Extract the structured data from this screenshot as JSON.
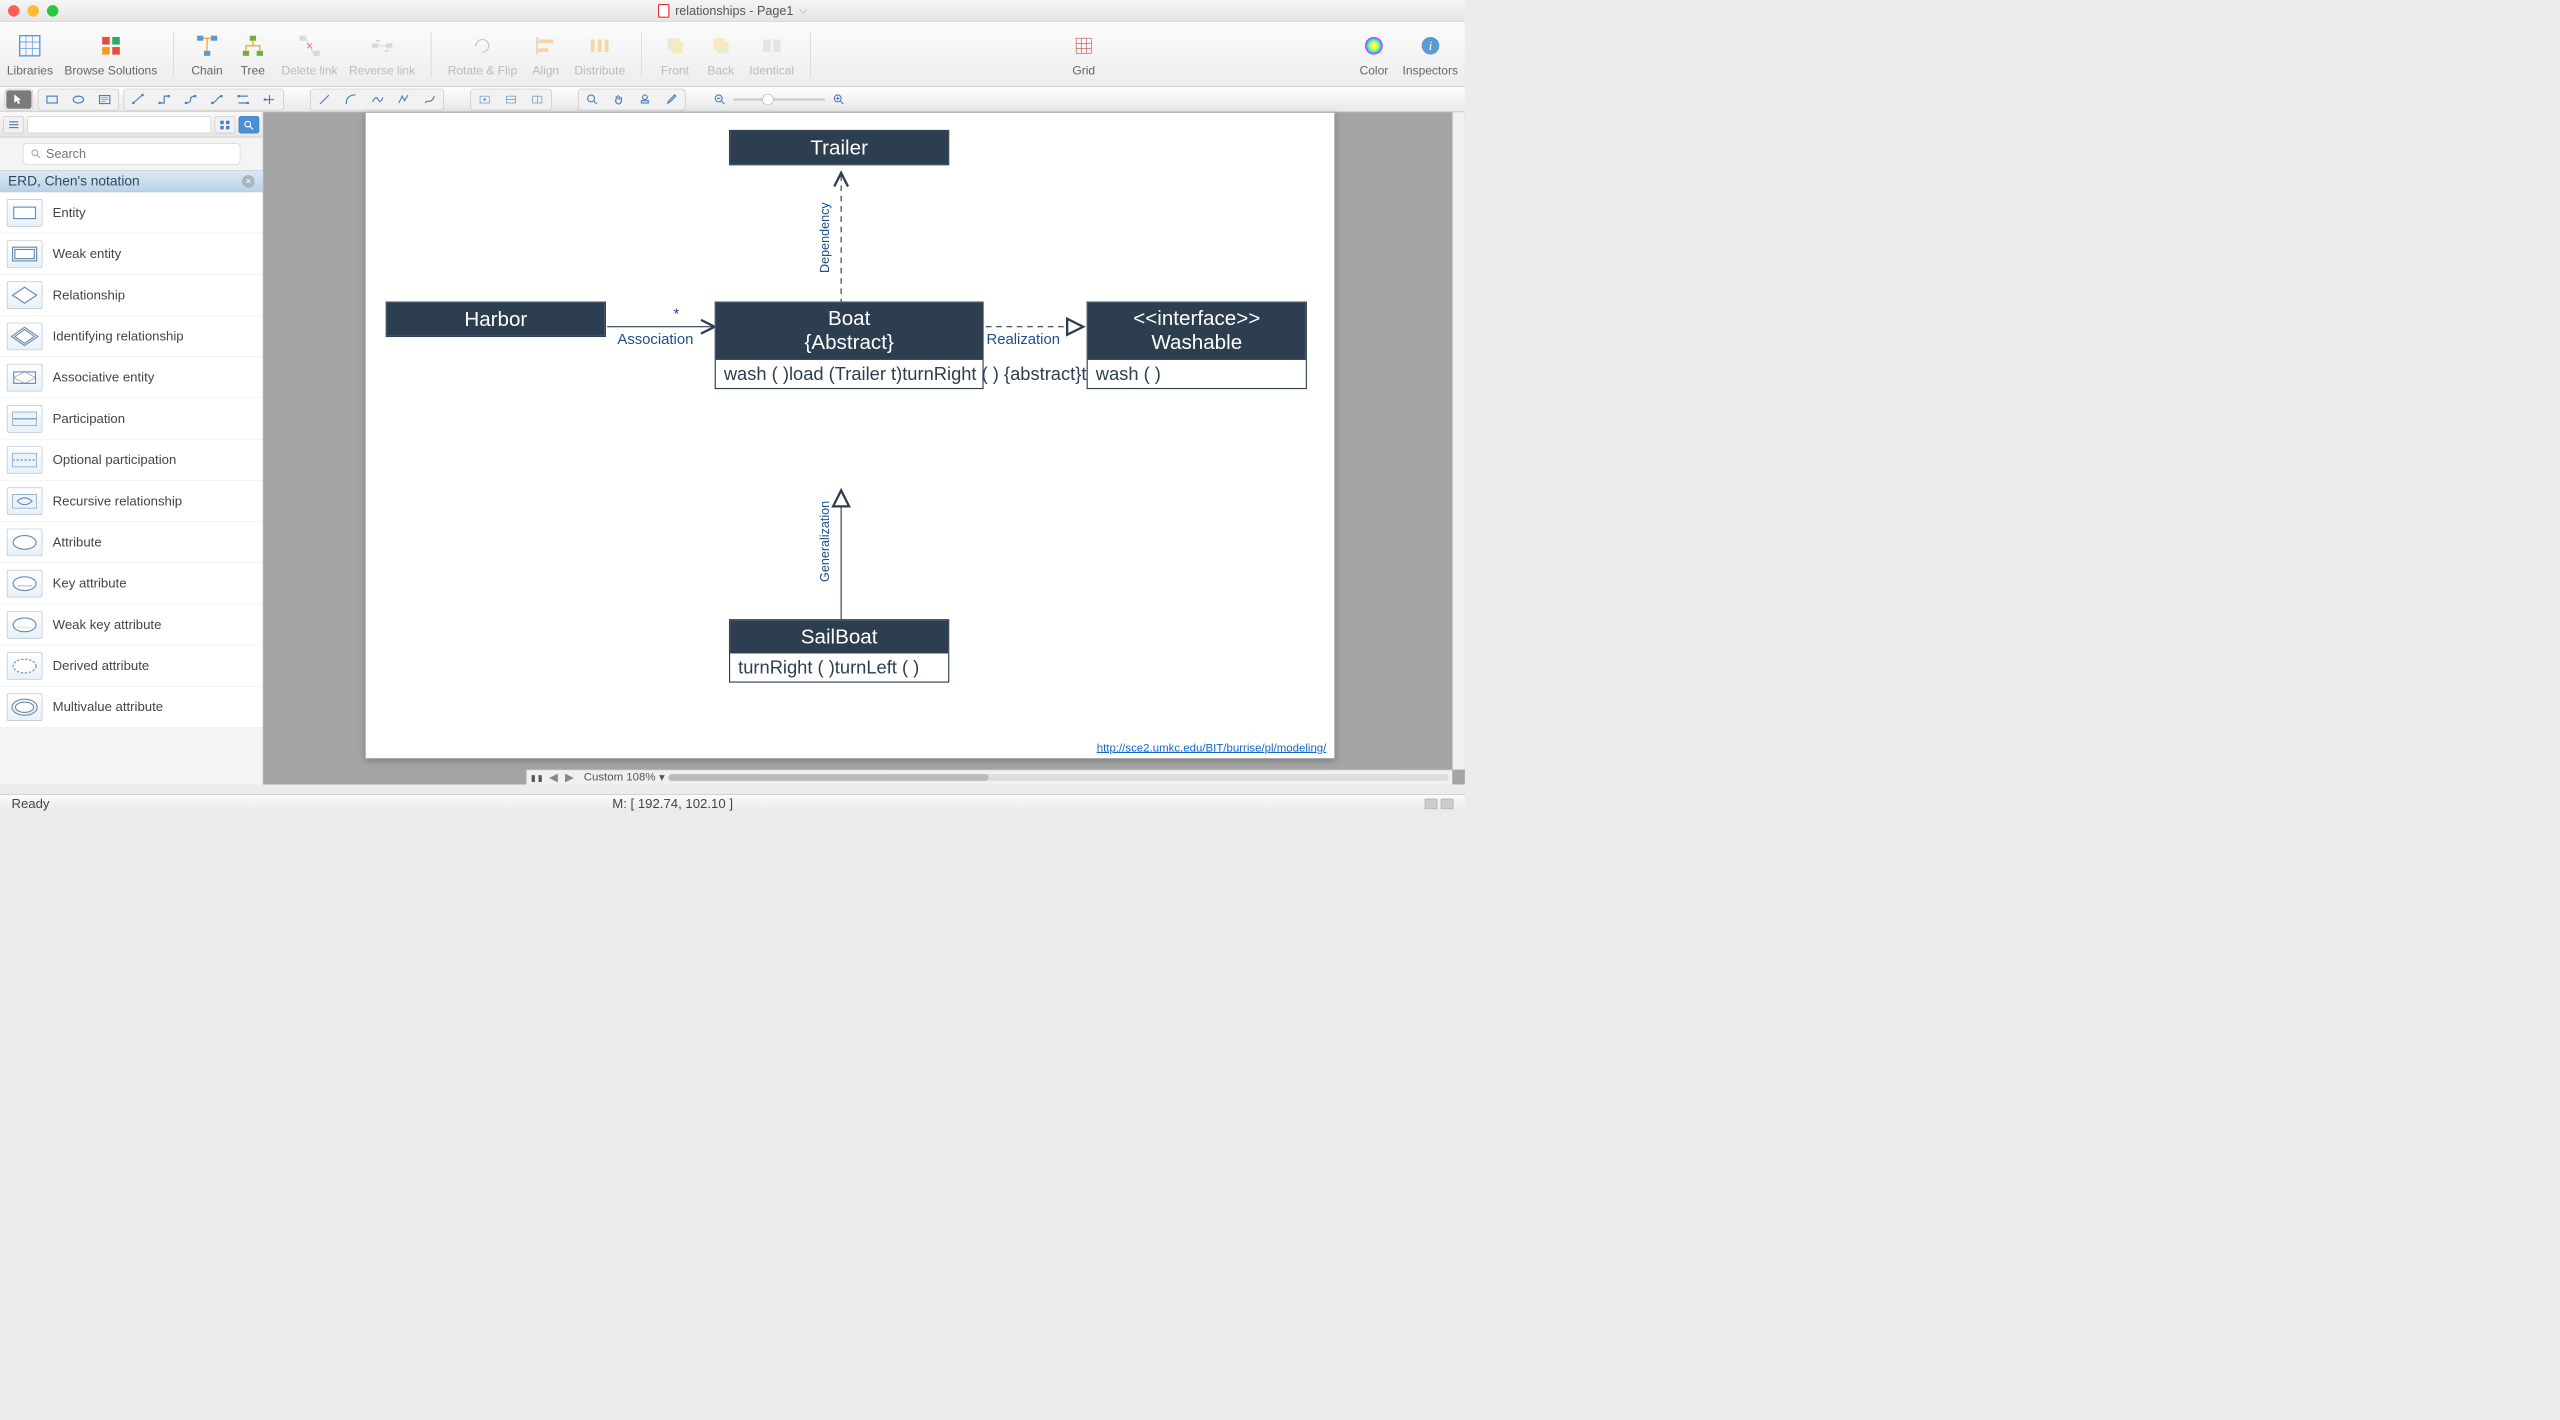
{
  "window": {
    "title": "relationships - Page1"
  },
  "toolbar": [
    {
      "label": "Libraries",
      "icon": "libraries"
    },
    {
      "label": "Browse Solutions",
      "icon": "browse"
    }
  ],
  "toolbar_link": [
    {
      "label": "Chain",
      "icon": "chain"
    },
    {
      "label": "Tree",
      "icon": "tree"
    },
    {
      "label": "Delete link",
      "icon": "del-link",
      "dim": true
    },
    {
      "label": "Reverse link",
      "icon": "rev-link",
      "dim": true
    }
  ],
  "toolbar_arrange": [
    {
      "label": "Rotate & Flip",
      "icon": "rotate",
      "dim": true
    },
    {
      "label": "Align",
      "icon": "align",
      "dim": true
    },
    {
      "label": "Distribute",
      "icon": "distribute",
      "dim": true
    }
  ],
  "toolbar_arrange2": [
    {
      "label": "Front",
      "icon": "front",
      "dim": true
    },
    {
      "label": "Back",
      "icon": "back",
      "dim": true
    },
    {
      "label": "Identical",
      "icon": "identical",
      "dim": true
    }
  ],
  "toolbar_right": [
    {
      "label": "Grid",
      "icon": "grid"
    }
  ],
  "toolbar_far_right": [
    {
      "label": "Color",
      "icon": "color"
    },
    {
      "label": "Inspectors",
      "icon": "inspectors"
    }
  ],
  "search": {
    "placeholder": "Search"
  },
  "category": {
    "title": "ERD, Chen's notation"
  },
  "lib_items": [
    "Entity",
    "Weak entity",
    "Relationship",
    "Identifying relationship",
    "Associative entity",
    "Participation",
    "Optional participation",
    "Recursive relationship",
    "Attribute",
    "Key attribute",
    "Weak key attribute",
    "Derived attribute",
    "Multivalue attribute"
  ],
  "diagram": {
    "trailer": {
      "title": "Trailer"
    },
    "harbor": {
      "title": "Harbor"
    },
    "boat": {
      "title": "Boat",
      "stereo": "{Abstract}",
      "methods": [
        "wash ( )",
        "load (Trailer t)",
        "turnRight ( ) {abstract}",
        "turnLeft ( ) {abstract}"
      ]
    },
    "washable": {
      "stereo": "<<interface>>",
      "title": "Washable",
      "methods": [
        "wash ( )"
      ]
    },
    "sailboat": {
      "title": "SailBoat",
      "methods": [
        "turnRight ( )",
        "turnLeft ( )"
      ]
    },
    "conn": {
      "association": "Association",
      "mult": "*",
      "dependency": "Dependency",
      "realization": "Realization",
      "generalization": "Generalization"
    },
    "source_url": "http://sce2.umkc.edu/BIT/burrise/pl/modeling/"
  },
  "footer": {
    "zoom_label": "Custom 108%",
    "status": "Ready",
    "mouse": "M: [ 192.74, 102.10 ]"
  }
}
